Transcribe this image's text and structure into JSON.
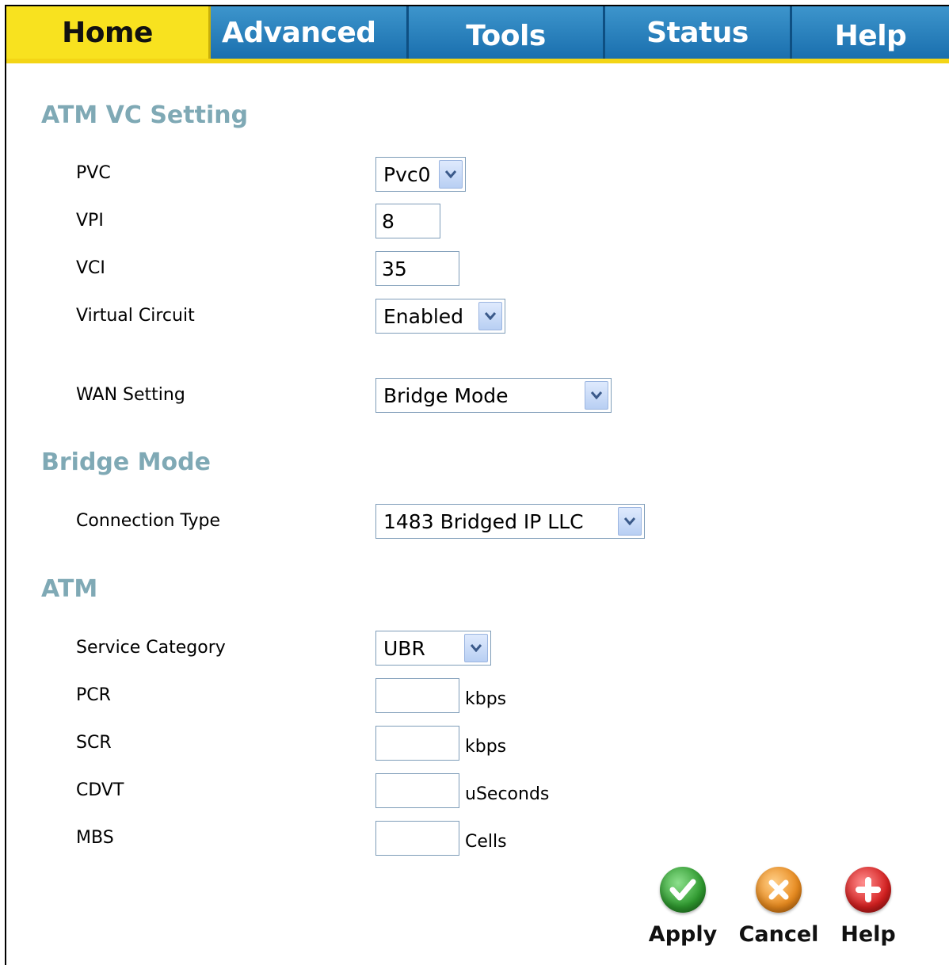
{
  "tabs": [
    {
      "label": "Home",
      "active": true
    },
    {
      "label": "Advanced",
      "active": false
    },
    {
      "label": "Tools",
      "active": false
    },
    {
      "label": "Status",
      "active": false
    },
    {
      "label": "Help",
      "active": false
    }
  ],
  "sections": {
    "atm_vc": "ATM VC Setting",
    "bridge": "Bridge Mode",
    "atm": "ATM"
  },
  "atm_vc": {
    "pvc_label": "PVC",
    "pvc_value": "Pvc0",
    "vpi_label": "VPI",
    "vpi_value": "8",
    "vci_label": "VCI",
    "vci_value": "35",
    "vc_label": "Virtual Circuit",
    "vc_value": "Enabled",
    "wan_label": "WAN Setting",
    "wan_value": "Bridge Mode"
  },
  "bridge": {
    "conn_label": "Connection Type",
    "conn_value": "1483 Bridged IP LLC"
  },
  "atm": {
    "service_label": "Service Category",
    "service_value": "UBR",
    "pcr_label": "PCR",
    "pcr_value": "",
    "pcr_unit": "kbps",
    "scr_label": "SCR",
    "scr_value": "",
    "scr_unit": "kbps",
    "cdvt_label": "CDVT",
    "cdvt_value": "",
    "cdvt_unit": "uSeconds",
    "mbs_label": "MBS",
    "mbs_value": "",
    "mbs_unit": "Cells"
  },
  "buttons": {
    "apply": "Apply",
    "cancel": "Cancel",
    "help": "Help"
  },
  "colors": {
    "tab_active": "#f8e21f",
    "tab_inactive": "#1b79b8",
    "section_heading": "#7fa9b5",
    "apply": "#2f9a2f",
    "cancel": "#e88a1e",
    "help": "#d42020"
  },
  "icons": {
    "select_arrow": "chevron-down-icon",
    "apply": "check-icon",
    "cancel": "x-icon",
    "help": "plus-icon"
  }
}
